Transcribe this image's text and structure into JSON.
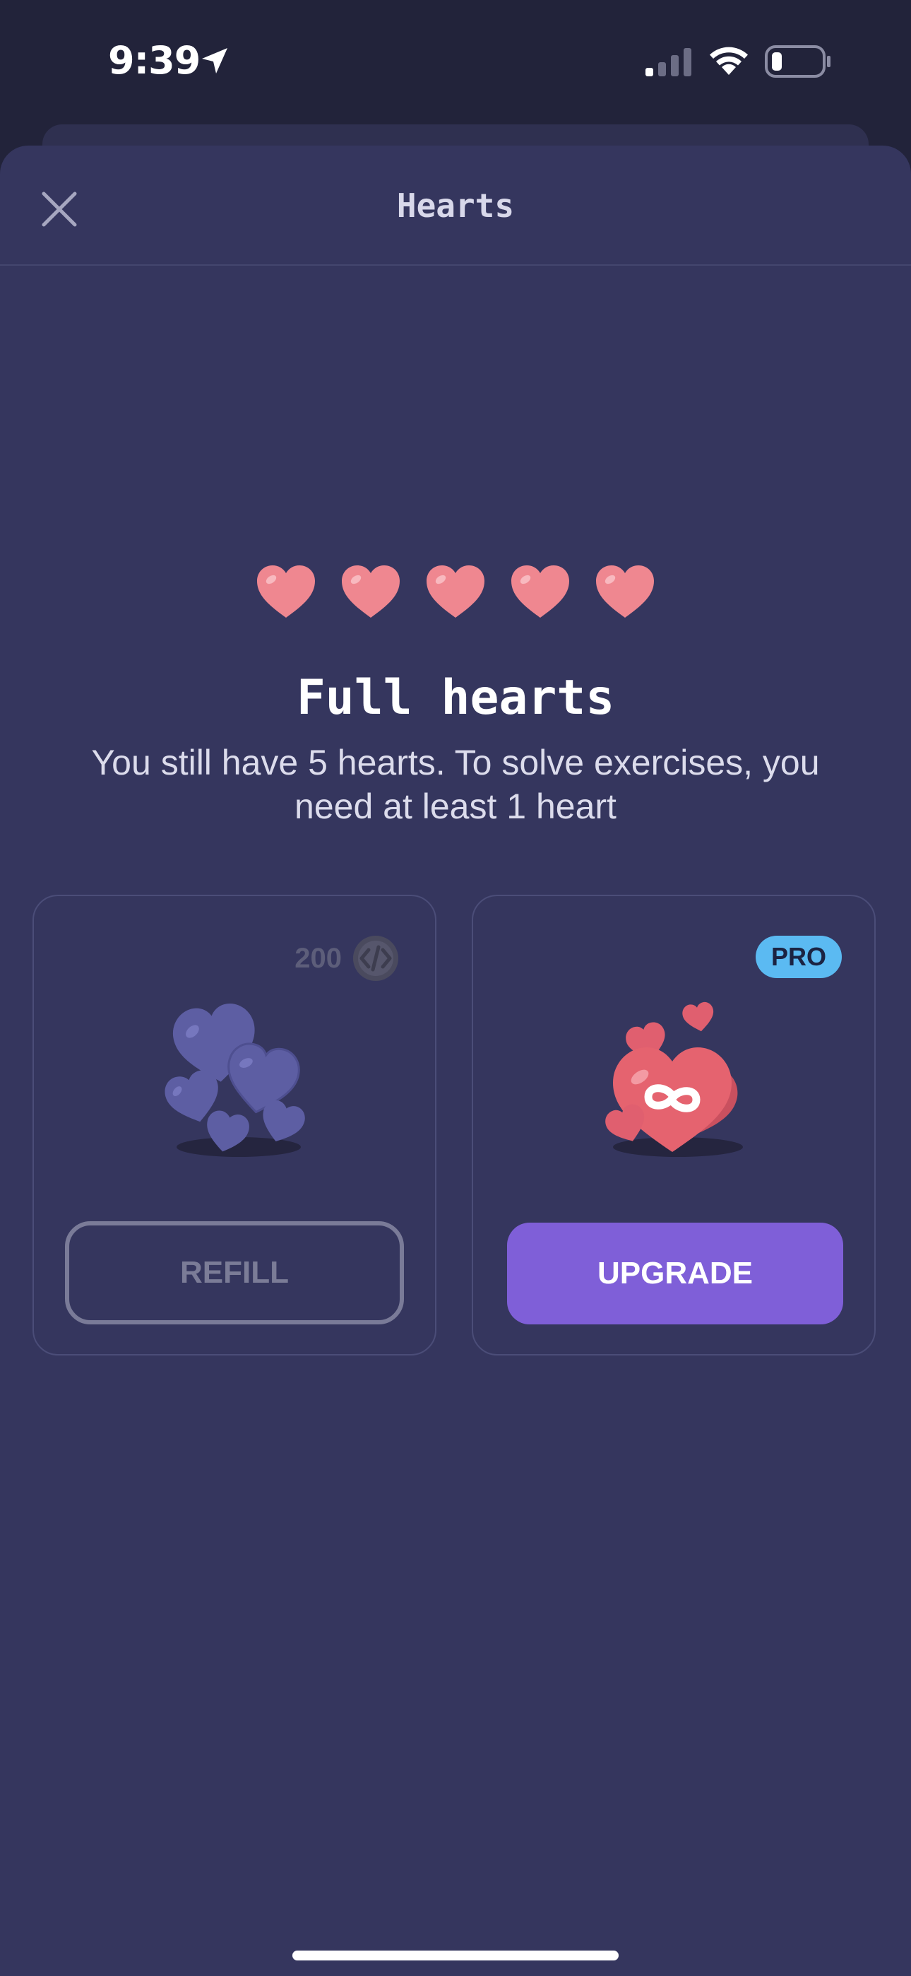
{
  "status_bar": {
    "time": "9:39"
  },
  "sheet": {
    "title": "Hearts"
  },
  "hearts": {
    "count": 5,
    "color": "#ef8790"
  },
  "main": {
    "headline": "Full hearts",
    "description": "You still have 5 hearts. To solve exercises, you need at least 1 heart"
  },
  "refill_card": {
    "price": "200",
    "button_label": "REFILL"
  },
  "pro_card": {
    "badge": "PRO",
    "button_label": "UPGRADE"
  },
  "colors": {
    "sheet_background": "#35365e",
    "accent_purple": "#7f5fd8",
    "pro_badge_blue": "#5bbaf2"
  }
}
